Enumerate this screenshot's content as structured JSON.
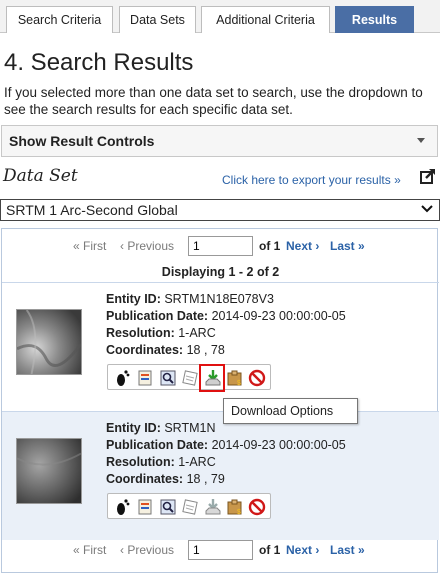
{
  "tabs": [
    {
      "label": "Search Criteria",
      "active": false
    },
    {
      "label": "Data Sets",
      "active": false
    },
    {
      "label": "Additional Criteria",
      "active": false
    },
    {
      "label": "Results",
      "active": true
    }
  ],
  "page_title": "4. Search Results",
  "intro_text": "If you selected more than one data set to search, use the dropdown to see the search results for each specific data set.",
  "controls_label": "Show Result Controls",
  "dataset_label": "Data Set",
  "export_link": "Click here to export your results »",
  "dataset_selected": "SRTM 1 Arc-Second Global",
  "pager": {
    "first": "« First",
    "previous": "‹ Previous",
    "page_value": "1",
    "of_text": "of 1",
    "next": "Next ›",
    "last": "Last »"
  },
  "displaying": "Displaying 1 - 2 of 2",
  "results": [
    {
      "entity_label": "Entity ID:",
      "entity_id": "SRTM1N18E078V3",
      "pub_label": "Publication Date:",
      "pub_date": "2014-09-23 00:00:00-05",
      "res_label": "Resolution:",
      "resolution": "1-ARC",
      "coord_label": "Coordinates:",
      "coordinates": "18 , 78"
    },
    {
      "entity_label": "Entity ID:",
      "entity_id": "SRTM1N",
      "pub_label": "Publication Date:",
      "pub_date": "2014-09-23 00:00:00-05",
      "res_label": "Resolution:",
      "resolution": "1-ARC",
      "coord_label": "Coordinates:",
      "coordinates": "18 , 79"
    }
  ],
  "result_icons": [
    "footprint-icon",
    "metadata-icon",
    "browse-overlay-icon",
    "compare-icon",
    "download-icon",
    "order-icon",
    "exclude-icon"
  ],
  "tooltip": "Download Options",
  "colors": {
    "tab_active": "#4a6ea5",
    "link": "#2b62a7",
    "highlight": "#e01010",
    "row_alt": "#eaf0f8"
  }
}
